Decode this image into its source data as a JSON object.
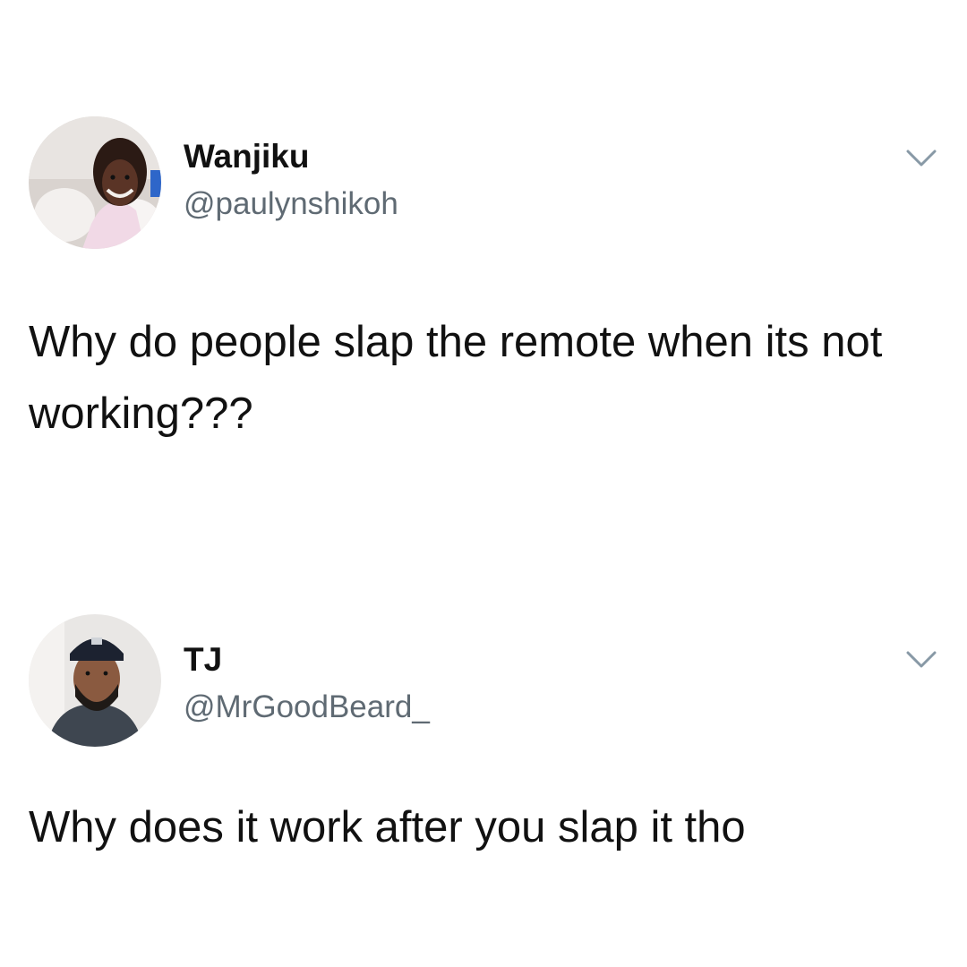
{
  "tweets": [
    {
      "name": "Wanjiku",
      "handle": "@paulynshikoh",
      "text": "Why do people slap the remote when its not working???",
      "avatar_icon": "profile-photo-icon",
      "menu_icon": "chevron-down-icon"
    },
    {
      "name": "TJ",
      "handle": "@MrGoodBeard_",
      "text": "Why does it work after you slap it tho",
      "avatar_icon": "profile-photo-icon",
      "menu_icon": "chevron-down-icon"
    }
  ],
  "colors": {
    "background": "#ffffff",
    "text": "#111111",
    "handle": "#5f6a73",
    "chevron": "#8899a6"
  }
}
